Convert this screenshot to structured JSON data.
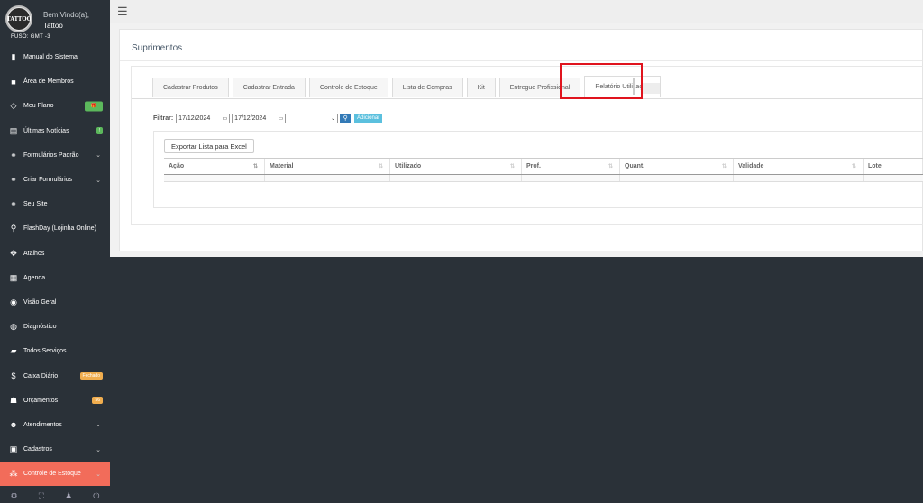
{
  "profile": {
    "avatar_text": "TATTOO",
    "welcome": "Bem Vindo(a),",
    "username": "Tattoo",
    "fuso": "FUSO: GMT -3"
  },
  "sidebar": {
    "items": [
      {
        "label": "Manual do Sistema",
        "icon": "book-icon",
        "glyph": "▮"
      },
      {
        "label": "Área de Membros",
        "icon": "video-icon",
        "glyph": "■"
      },
      {
        "label": "Meu Plano",
        "icon": "diamond-icon",
        "glyph": "◇",
        "badge": "🎁"
      },
      {
        "label": "Últimas Notícias",
        "icon": "news-icon",
        "glyph": "▤",
        "badge": "!"
      },
      {
        "label": "Formulários Padrão",
        "icon": "link-icon",
        "glyph": "⚭",
        "chevron": true
      },
      {
        "label": "Criar Formulários",
        "icon": "link-icon",
        "glyph": "⚭",
        "chevron": true
      },
      {
        "label": "Seu Site",
        "icon": "link-icon",
        "glyph": "⚭"
      },
      {
        "label": "FlashDay (Lojinha Online)",
        "icon": "map-marker-icon",
        "glyph": "⚲"
      },
      {
        "label": "Atalhos",
        "icon": "signpost-icon",
        "glyph": "✥"
      },
      {
        "label": "Agenda",
        "icon": "calendar-icon",
        "glyph": "▦"
      },
      {
        "label": "Visão Geral",
        "icon": "eye-icon",
        "glyph": "◉"
      },
      {
        "label": "Diagnóstico",
        "icon": "dashboard-icon",
        "glyph": "◍"
      },
      {
        "label": "Todos Serviços",
        "icon": "folder-icon",
        "glyph": "▰"
      },
      {
        "label": "Caixa Diário",
        "icon": "dollar-icon",
        "glyph": "$",
        "badge": "Fechado"
      },
      {
        "label": "Orçamentos",
        "icon": "users-icon",
        "glyph": "☗",
        "badge": "56"
      },
      {
        "label": "Atendimentos",
        "icon": "user-icon",
        "glyph": "☻",
        "chevron": true
      },
      {
        "label": "Cadastros",
        "icon": "save-icon",
        "glyph": "▣",
        "chevron": true
      },
      {
        "label": "Controle de Estoque",
        "icon": "cubes-icon",
        "glyph": "⁂",
        "chevron": true
      }
    ],
    "footer": [
      "⚙",
      "⛶",
      "♟",
      "⏻"
    ]
  },
  "page": {
    "title": "Suprimentos"
  },
  "tabs": [
    "Cadastrar Produtos",
    "Cadastrar Entrada",
    "Controle de Estoque",
    "Lista de Compras",
    "Kit",
    "Entregue Profissional",
    "Relatório Utilização"
  ],
  "filter": {
    "label": "Filtrar:",
    "date_from": "17/12/2024",
    "date_to": "17/12/2024",
    "select_value": "",
    "add_label": "Adicionar"
  },
  "export_label": "Exportar Lista para Excel",
  "table": {
    "columns": [
      "Ação",
      "Material",
      "Utilizado",
      "Prof.",
      "Quant.",
      "Validade",
      "Lote"
    ]
  },
  "colors": {
    "sidebar_bg": "#2a3138",
    "active_item": "#f26c5a",
    "highlight": "#e0141e",
    "primary": "#337ab7",
    "info": "#5bc0de"
  }
}
